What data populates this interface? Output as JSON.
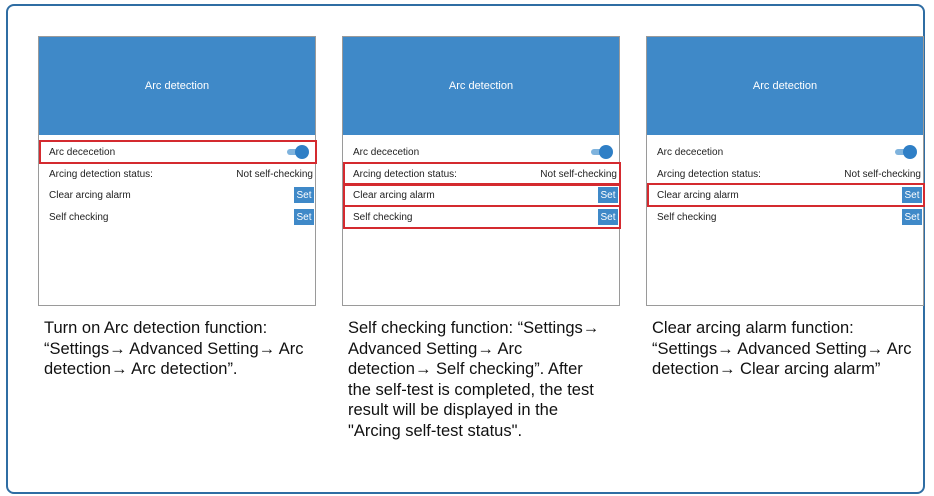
{
  "colors": {
    "frame_border": "#2f6da3",
    "header_blue": "#3f89c8",
    "highlight_red": "#d42a2f",
    "toggle_on": "#2f7fc6"
  },
  "panels": [
    {
      "header_title": "Arc detection",
      "rows": [
        {
          "label": "Arc dececetion",
          "control": "toggle-on"
        },
        {
          "label": "Arcing detection status:",
          "value": "Not self-checking"
        },
        {
          "label": "Clear arcing alarm",
          "button": "Set"
        },
        {
          "label": "Self checking",
          "button": "Set"
        }
      ],
      "highlighted_rows": [
        "Arc dececetion"
      ],
      "caption": "Turn on Arc detection function: “Settings→ Advanced Setting→ Arc detection→ Arc detection”."
    },
    {
      "header_title": "Arc detection",
      "rows": [
        {
          "label": "Arc dececetion",
          "control": "toggle-on"
        },
        {
          "label": "Arcing detection status:",
          "value": "Not self-checking"
        },
        {
          "label": "Clear arcing alarm",
          "button": "Set"
        },
        {
          "label": "Self checking",
          "button": "Set"
        }
      ],
      "highlighted_rows": [
        "Arcing detection status:",
        "Clear arcing alarm",
        "Self checking"
      ],
      "caption": "Self checking function: “Settings→ Advanced Setting→ Arc detection→ Self checking”. After the self-test is completed, the test result will be displayed in the \"Arcing self-test status\"."
    },
    {
      "header_title": "Arc detection",
      "rows": [
        {
          "label": "Arc dececetion",
          "control": "toggle-on"
        },
        {
          "label": "Arcing detection status:",
          "value": "Not self-checking"
        },
        {
          "label": "Clear arcing alarm",
          "button": "Set"
        },
        {
          "label": "Self checking",
          "button": "Set"
        }
      ],
      "highlighted_rows": [
        "Clear arcing alarm"
      ],
      "caption": "Clear arcing alarm function: “Settings→ Advanced Setting→ Arc detection→ Clear arcing alarm”"
    }
  ]
}
